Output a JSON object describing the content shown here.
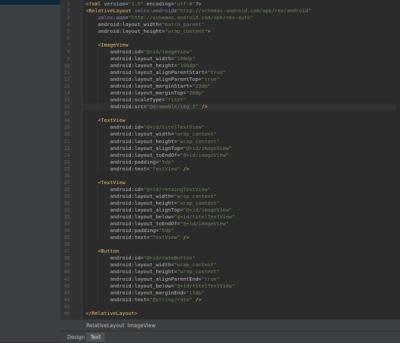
{
  "editor": {
    "gutter_numbers": [
      "1",
      "2",
      "3",
      "4",
      "5",
      "6",
      "7",
      "8",
      "9",
      "10",
      "11",
      "12",
      "13",
      "14",
      "15",
      "16",
      "17",
      "18",
      "19",
      "20",
      "21",
      "22",
      "23",
      "24",
      "25",
      "26",
      "27",
      "28",
      "29",
      "30",
      "31",
      "32",
      "33",
      "34",
      "35",
      "36",
      "37",
      "38",
      "39",
      "40",
      "41",
      "42",
      "43",
      "44",
      "45",
      "46"
    ],
    "lines": [
      "<?xml version=\"1.0\" encoding=\"utf-8\"?>",
      "<RelativeLayout xmlns:android=\"http://schemas.android.com/apk/res/android\"",
      "    xmlns:app=\"http://schemas.android.com/apk/res-auto\"",
      "    android:layout_width=\"match_parent\"",
      "    android:layout_height=\"wrap_content\">",
      "",
      "    <ImageView",
      "        android:id=\"@+id/imageView\"",
      "        android:layout_width=\"100dp\"",
      "        android:layout_height=\"100dp\"",
      "        android:layout_alignParentStart=\"true\"",
      "        android:layout_alignParentTop=\"true\"",
      "        android:layout_marginStart=\"23dp\"",
      "        android:layout_marginTop=\"20dp\"",
      "        android:scaleType=\"fitXY\"",
      "        android:src=\"@drawable/img_1\" />",
      "",
      "    <TextView",
      "        android:id=\"@+id/titelTextView\"",
      "        android:layout_width=\"wrap_content\"",
      "        android:layout_height=\"wrap_content\"",
      "        android:layout_alignTop=\"@+id/imageView\"",
      "        android:layout_toEndOf=\"@+id/imageView\"",
      "        android:padding=\"5dp\"",
      "        android:text=\"TextView\" />",
      "",
      "    <TextView",
      "        android:id=\"@+id/retaingTextView\"",
      "        android:layout_width=\"wrap_content\"",
      "        android:layout_height=\"wrap_content\"",
      "        android:layout_alignTop=\"@+id/imageView\"",
      "        android:layout_below=\"@+id/titelTextView\"",
      "        android:layout_toEndOf=\"@+id/imageView\"",
      "        android:padding=\"5dp\"",
      "        android:text=\"TextView\" />",
      "",
      "    <Button",
      "        android:id=\"@+id/rateButton\"",
      "        android:layout_width=\"wrap_content\"",
      "        android:layout_height=\"wrap_content\"",
      "        android:layout_alignParentEnd=\"true\"",
      "        android:layout_below=\"@+id/titelTextView\"",
      "        android:layout_marginEnd=\"11dp\"",
      "        android:text=\"@string/rate\" />",
      "",
      "</RelativeLayout>"
    ],
    "current_line": 16
  },
  "breadcrumb": {
    "items": [
      "RelativeLayout",
      "ImageView"
    ]
  },
  "tabs": {
    "design": "Design",
    "text": "Text",
    "active": "Text"
  }
}
